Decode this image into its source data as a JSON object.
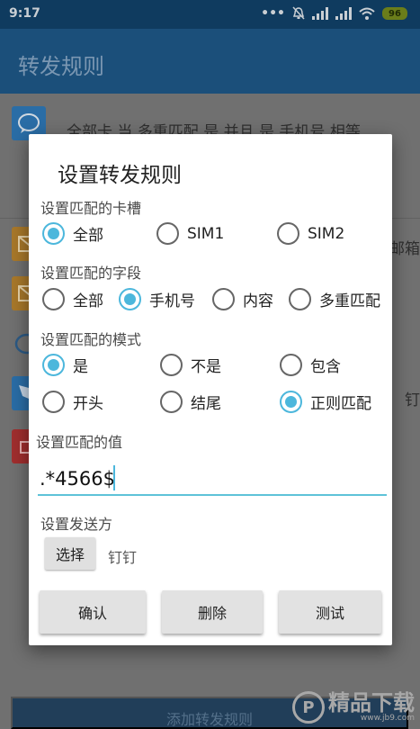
{
  "status_bar": {
    "time": "9:17",
    "battery": "96",
    "icons": [
      "more-dots-icon",
      "alarm-off-icon",
      "signal-icon",
      "signal-icon",
      "wifi-icon",
      "battery-icon"
    ]
  },
  "app": {
    "title": "转发规则",
    "first_rule_text": "全部卡 当 多重匹配 是 并且 是 手机号 相等",
    "side_fragments": [
      "邮箱",
      "钉"
    ],
    "add_button": "添加转发规则"
  },
  "dialog": {
    "title": "设置转发规则",
    "sim_section": {
      "label": "设置匹配的卡槽",
      "options": [
        "全部",
        "SIM1",
        "SIM2"
      ],
      "selected": "全部"
    },
    "field_section": {
      "label": "设置匹配的字段",
      "options": [
        "全部",
        "手机号",
        "内容",
        "多重匹配"
      ],
      "selected": "手机号"
    },
    "mode_section": {
      "label": "设置匹配的模式",
      "options": [
        "是",
        "不是",
        "包含",
        "开头",
        "结尾",
        "正则匹配"
      ],
      "selected": [
        "是",
        "正则匹配"
      ]
    },
    "value_section": {
      "label": "设置匹配的值",
      "value": ".*4566$"
    },
    "sender_section": {
      "label": "设置发送方",
      "choose_button": "选择",
      "selected_sender": "钉钉"
    },
    "buttons": {
      "confirm": "确认",
      "delete": "删除",
      "test": "测试"
    }
  },
  "watermark": {
    "logo_letter": "P",
    "text": "精品下载",
    "url": "www.jb9.com"
  },
  "colors": {
    "accent": "#4cb7dc",
    "appbar": "#1b4f7a",
    "statusbar": "#0f3b5f"
  }
}
